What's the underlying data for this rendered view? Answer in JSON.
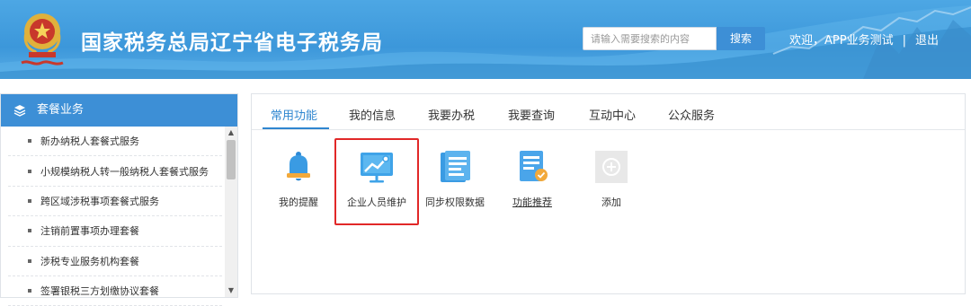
{
  "header": {
    "title": "国家税务总局辽宁省电子税务局",
    "emblem_icon": "tax-emblem-icon",
    "search_placeholder": "请输入需要搜索的内容",
    "search_button": "搜索",
    "greeting": "欢迎，APP业务测试",
    "separator": "|",
    "logout": "退出"
  },
  "sidebar": {
    "title": "套餐业务",
    "title_icon": "layers-icon",
    "items": [
      {
        "label": "新办纳税人套餐式服务"
      },
      {
        "label": "小规模纳税人转一般纳税人套餐式服务"
      },
      {
        "label": "跨区域涉税事项套餐式服务"
      },
      {
        "label": "注销前置事项办理套餐"
      },
      {
        "label": "涉税专业服务机构套餐"
      },
      {
        "label": "签署银税三方划缴协议套餐"
      }
    ]
  },
  "tabs": [
    {
      "label": "常用功能",
      "active": true
    },
    {
      "label": "我的信息",
      "active": false
    },
    {
      "label": "我要办税",
      "active": false
    },
    {
      "label": "我要查询",
      "active": false
    },
    {
      "label": "互动中心",
      "active": false
    },
    {
      "label": "公众服务",
      "active": false
    }
  ],
  "functions": [
    {
      "label": "我的提醒",
      "icon": "bell-icon"
    },
    {
      "label": "企业人员维护",
      "icon": "presentation-board-icon",
      "highlighted": true
    },
    {
      "label": "同步权限数据",
      "icon": "document-sync-icon"
    },
    {
      "label": "功能推荐",
      "icon": "document-check-icon"
    },
    {
      "label": "添加",
      "icon": "add-icon"
    }
  ],
  "colors": {
    "header_blue": "#3c97da",
    "accent_blue": "#3d8fd6",
    "active_tab": "#2f86d0",
    "highlight_red": "#e12828"
  }
}
